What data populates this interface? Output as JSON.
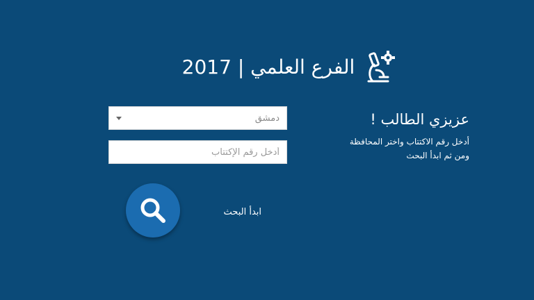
{
  "header": {
    "title": "الفرع العلمي | 2017",
    "icon": "microscope-gear-icon"
  },
  "form": {
    "governorate_selected": "دمشق",
    "subscription_placeholder": "أدخل رقم الإكتتاب",
    "search_icon": "search-icon",
    "start_label": "ابدأ البحث"
  },
  "info": {
    "title": "عزيزي الطالب !",
    "line1": "أدخل رقم الاكتتاب واختر المحافظة",
    "line2": "ومن ثم ابدأ البحث"
  },
  "colors": {
    "background": "#0b4a78",
    "button": "#1b6cb0",
    "text": "#ffffff"
  }
}
